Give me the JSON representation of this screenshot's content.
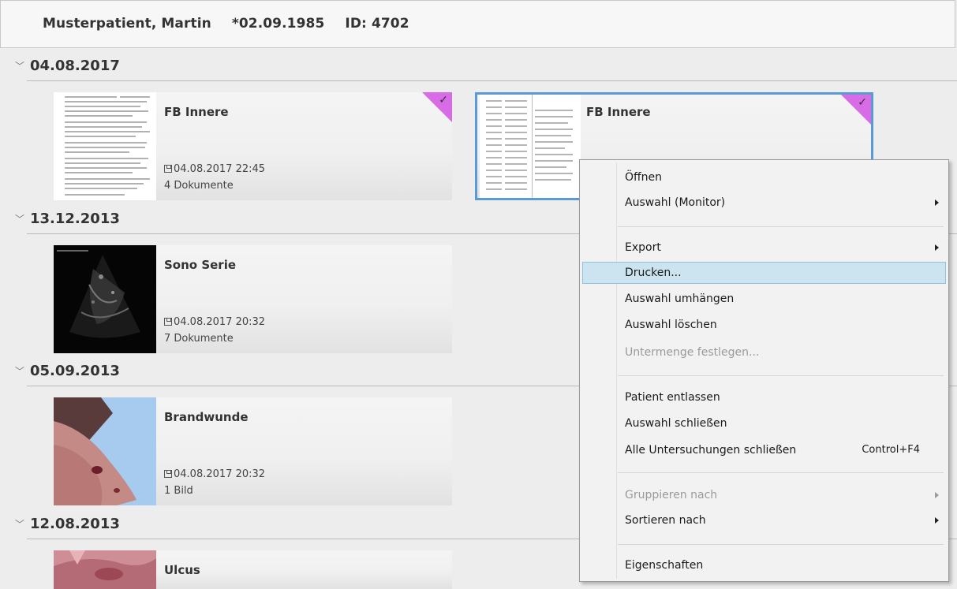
{
  "header": {
    "patient_name": "Musterpatient, Martin",
    "birth_date": "*02.09.1985",
    "patient_id": "ID: 4702"
  },
  "groups": [
    {
      "date": "04.08.2017"
    },
    {
      "date": "13.12.2013"
    },
    {
      "date": "05.09.2013"
    },
    {
      "date": "12.08.2013"
    }
  ],
  "cards": [
    {
      "title": "FB Innere",
      "date": "04.08.2017 22:45",
      "count": "4 Dokumente",
      "checked": true
    },
    {
      "title": "FB Innere",
      "checked": true,
      "selected": true
    },
    {
      "title": "Sono Serie",
      "date": "04.08.2017 20:32",
      "count": "7 Dokumente"
    },
    {
      "title": "Brandwunde",
      "date": "04.08.2017 20:32",
      "count": "1 Bild"
    },
    {
      "title": "Ulcus"
    }
  ],
  "icons": {
    "chevron": "chevron-down-icon",
    "save": "save-icon",
    "check": "checkmark-icon",
    "submenu": "submenu-arrow-icon"
  },
  "colors": {
    "check_corner": "#d86be6",
    "selection_border": "#5a9bd5",
    "menu_hover": "#cce4f0"
  },
  "context_menu": {
    "items": [
      {
        "label": "Öffnen"
      },
      {
        "label": "Auswahl (Monitor)",
        "submenu": true
      },
      {
        "label": "Export",
        "submenu": true
      },
      {
        "label": "Drucken...",
        "hover": true
      },
      {
        "label": "Auswahl umhängen"
      },
      {
        "label": "Auswahl löschen"
      },
      {
        "label": "Untermenge festlegen...",
        "disabled": true
      },
      {
        "label": "Patient entlassen"
      },
      {
        "label": "Auswahl schließen"
      },
      {
        "label": "Alle Untersuchungen schließen",
        "shortcut": "Control+F4"
      },
      {
        "label": "Gruppieren nach",
        "submenu": true,
        "disabled": true
      },
      {
        "label": "Sortieren nach",
        "submenu": true
      },
      {
        "label": "Eigenschaften"
      }
    ]
  }
}
